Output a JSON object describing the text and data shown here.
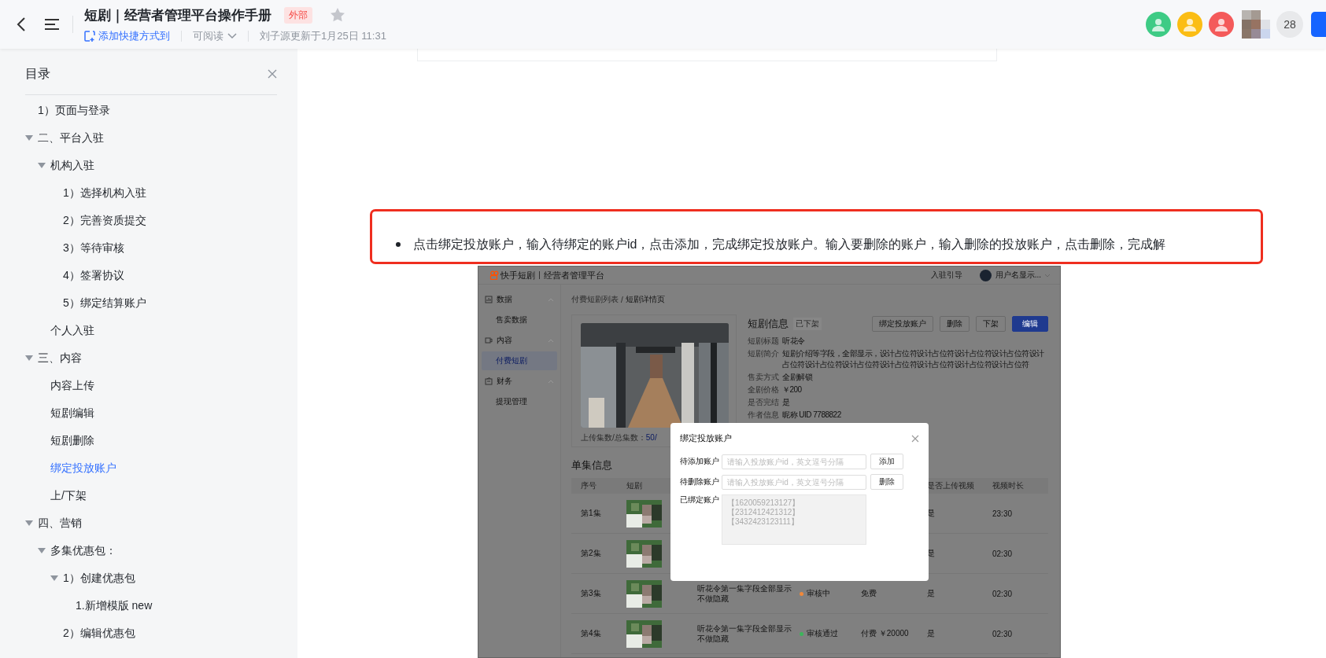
{
  "document_header": {
    "title": "短剧｜经营者管理平台操作手册",
    "badge": "外部",
    "starred": false,
    "shortcut_link": "添加快捷方式到",
    "permission": "可阅读",
    "updated": "刘子源更新于1月25日 11:31",
    "collaborators": [
      {
        "color": "#3ecb85"
      },
      {
        "color": "#fbbd14"
      },
      {
        "color": "#f45a5a"
      }
    ],
    "collaborator_count": "28"
  },
  "toc": {
    "title": "目录",
    "items": [
      {
        "label": "1）页面与登录",
        "selected": false
      },
      {
        "label": "二、平台入驻",
        "selected": false,
        "expanded": true,
        "children": [
          {
            "label": "机构入驻",
            "selected": false,
            "expanded": true,
            "children": [
              {
                "label": "1）选择机构入驻",
                "selected": false
              },
              {
                "label": "2）完善资质提交",
                "selected": false
              },
              {
                "label": "3）等待审核",
                "selected": false
              },
              {
                "label": "4）签署协议",
                "selected": false
              },
              {
                "label": "5）绑定结算账户",
                "selected": false
              }
            ]
          },
          {
            "label": "个人入驻",
            "selected": false
          }
        ]
      },
      {
        "label": "三、内容",
        "selected": false,
        "expanded": true,
        "children": [
          {
            "label": "内容上传",
            "selected": false
          },
          {
            "label": "短剧编辑",
            "selected": false
          },
          {
            "label": "短剧删除",
            "selected": false
          },
          {
            "label": "绑定投放账户",
            "selected": true
          },
          {
            "label": "上/下架",
            "selected": false
          }
        ]
      },
      {
        "label": "四、营销",
        "selected": false,
        "expanded": true,
        "children": [
          {
            "label": "多集优惠包：",
            "selected": false,
            "expanded": true,
            "children": [
              {
                "label": "1）创建优惠包",
                "selected": false,
                "expanded": true,
                "children": [
                  {
                    "label": "1.新增模版 new",
                    "selected": false
                  }
                ]
              },
              {
                "label": "2）编辑优惠包",
                "selected": false
              }
            ]
          }
        ]
      }
    ]
  },
  "step_text": "点击绑定投放账户，输入待绑定的账户id，点击添加，完成绑定投放账户。输入要删除的账户，输入删除的投放账户，点击删除，完成解",
  "screenshot": {
    "brand": "快手短剧",
    "platform": "经营者管理平台",
    "guide_link": "入驻引导",
    "user_name": "用户名显示...",
    "nav": [
      {
        "label": "数据",
        "kind": "group",
        "expanded": true
      },
      {
        "label": "售卖数据",
        "kind": "item",
        "selected": false
      },
      {
        "label": "内容",
        "kind": "group",
        "expanded": true
      },
      {
        "label": "付费短剧",
        "kind": "item",
        "selected": true
      },
      {
        "label": "财务",
        "kind": "group",
        "expanded": true
      },
      {
        "label": "提现管理",
        "kind": "item",
        "selected": false
      }
    ],
    "breadcrumb": {
      "parent": "付费短剧列表",
      "separator": "/",
      "current": "短剧详情页"
    },
    "upload_label": "上传集数/总集数：",
    "upload_value": "50/",
    "info_title": "短剧信息",
    "status_tag": "已下架",
    "actions": [
      {
        "label": "绑定投放账户",
        "primary": false
      },
      {
        "label": "删除",
        "primary": false
      },
      {
        "label": "下架",
        "primary": false
      },
      {
        "label": "编辑",
        "primary": true
      }
    ],
    "fields": [
      {
        "label": "短剧标题",
        "value": "听花令"
      },
      {
        "label": "短剧简介",
        "value": "短剧介绍等字段，全部显示，设计占位符设计占位符设计占位符设计占位符设计占位符设计占位符设计占位符设计占位符设计占位符设计占位符设计占位符"
      },
      {
        "label": "售卖方式",
        "value": "全剧解锁"
      },
      {
        "label": "全剧价格",
        "value": "￥200"
      },
      {
        "label": "是否完结",
        "value": "是"
      },
      {
        "label": "作者信息",
        "value": "昵称 UID 7788822"
      }
    ],
    "episodes_title": "单集信息",
    "columns": {
      "index": "序号",
      "drama": "短剧",
      "uploaded": "是否上传视频",
      "duration": "视频时长"
    },
    "episodes": [
      {
        "index": "第1集",
        "uploaded": "是",
        "duration": "23:30"
      },
      {
        "index": "第2集",
        "uploaded": "是",
        "duration": "02:30"
      },
      {
        "index": "第3集",
        "title": "听花令第一集字段全部显示不做隐藏",
        "status": "审核中",
        "color": "#f0883a",
        "price": "免费",
        "uploaded": "是",
        "duration": "02:30"
      },
      {
        "index": "第4集",
        "title": "听花令第一集字段全部显示不做隐藏",
        "status": "审核通过",
        "color": "#3cb55a",
        "price": "付费 ￥20000",
        "uploaded": "是",
        "duration": "02:30"
      }
    ],
    "modal": {
      "title": "绑定投放账户",
      "rows": [
        {
          "label": "待添加账户",
          "placeholder": "请输入投放账户id，英文逗号分隔",
          "button": "添加"
        },
        {
          "label": "待删除账户",
          "placeholder": "请输入投放账户id，英文逗号分隔",
          "button": "删除"
        }
      ],
      "bound_label": "已绑定账户",
      "bound_accounts": [
        "【1620059213127】",
        "【2312412421312】",
        "【3432423123111】"
      ]
    }
  }
}
